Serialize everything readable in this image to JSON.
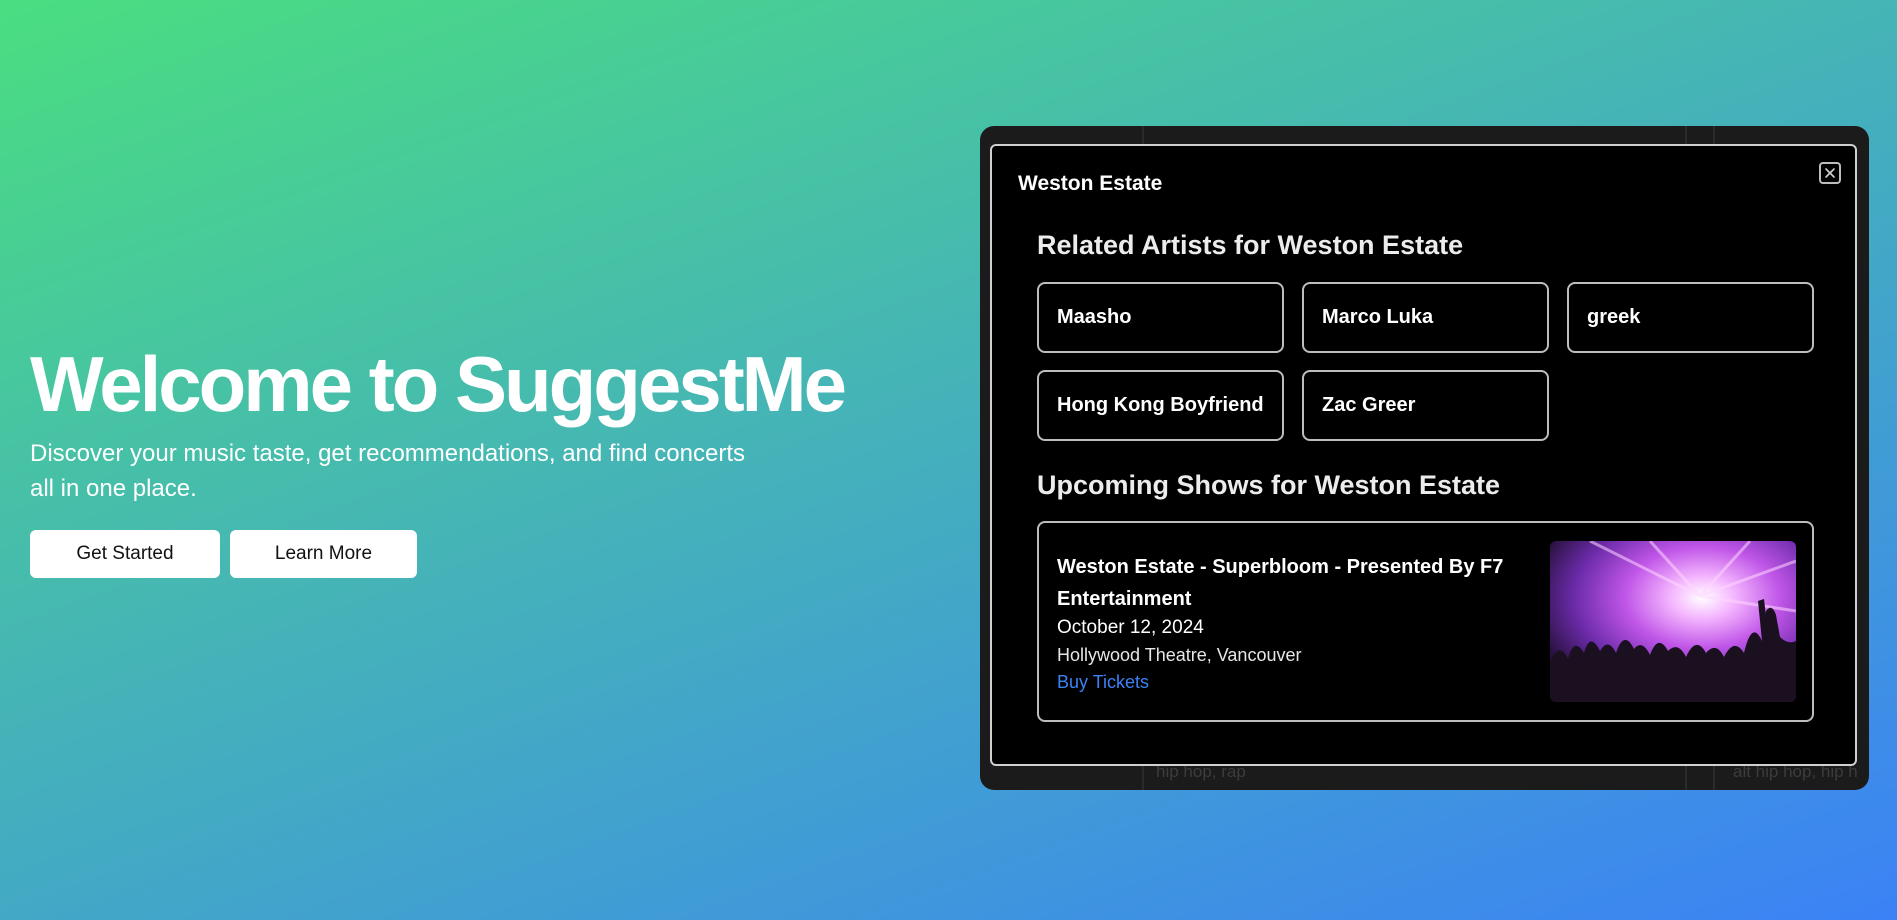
{
  "hero": {
    "title": "Welcome to SuggestMe",
    "subtitle": "Discover your music taste, get recommendations, and find concerts all in one place.",
    "get_started_label": "Get Started",
    "learn_more_label": "Learn More"
  },
  "backdrop": {
    "genre_left": "hip hop, rap",
    "genre_right": "alt hip hop, hip h"
  },
  "modal": {
    "title": "Weston Estate",
    "related_title": "Related Artists for Weston Estate",
    "artists": [
      "Maasho",
      "Marco Luka",
      "greek",
      "Hong Kong Boyfriend",
      "Zac Greer"
    ],
    "shows_title": "Upcoming Shows for Weston Estate",
    "show": {
      "name": "Weston Estate - Superbloom - Presented By F7 Entertainment",
      "date": "October 12, 2024",
      "venue": "Hollywood Theatre, Vancouver",
      "link_label": "Buy Tickets"
    }
  },
  "colors": {
    "gradient_start": "#4ade80",
    "gradient_end": "#3b82f6",
    "link": "#3b82f6",
    "modal_bg": "#000000"
  },
  "icons": {
    "close": "close-icon",
    "concert": "concert-image"
  }
}
